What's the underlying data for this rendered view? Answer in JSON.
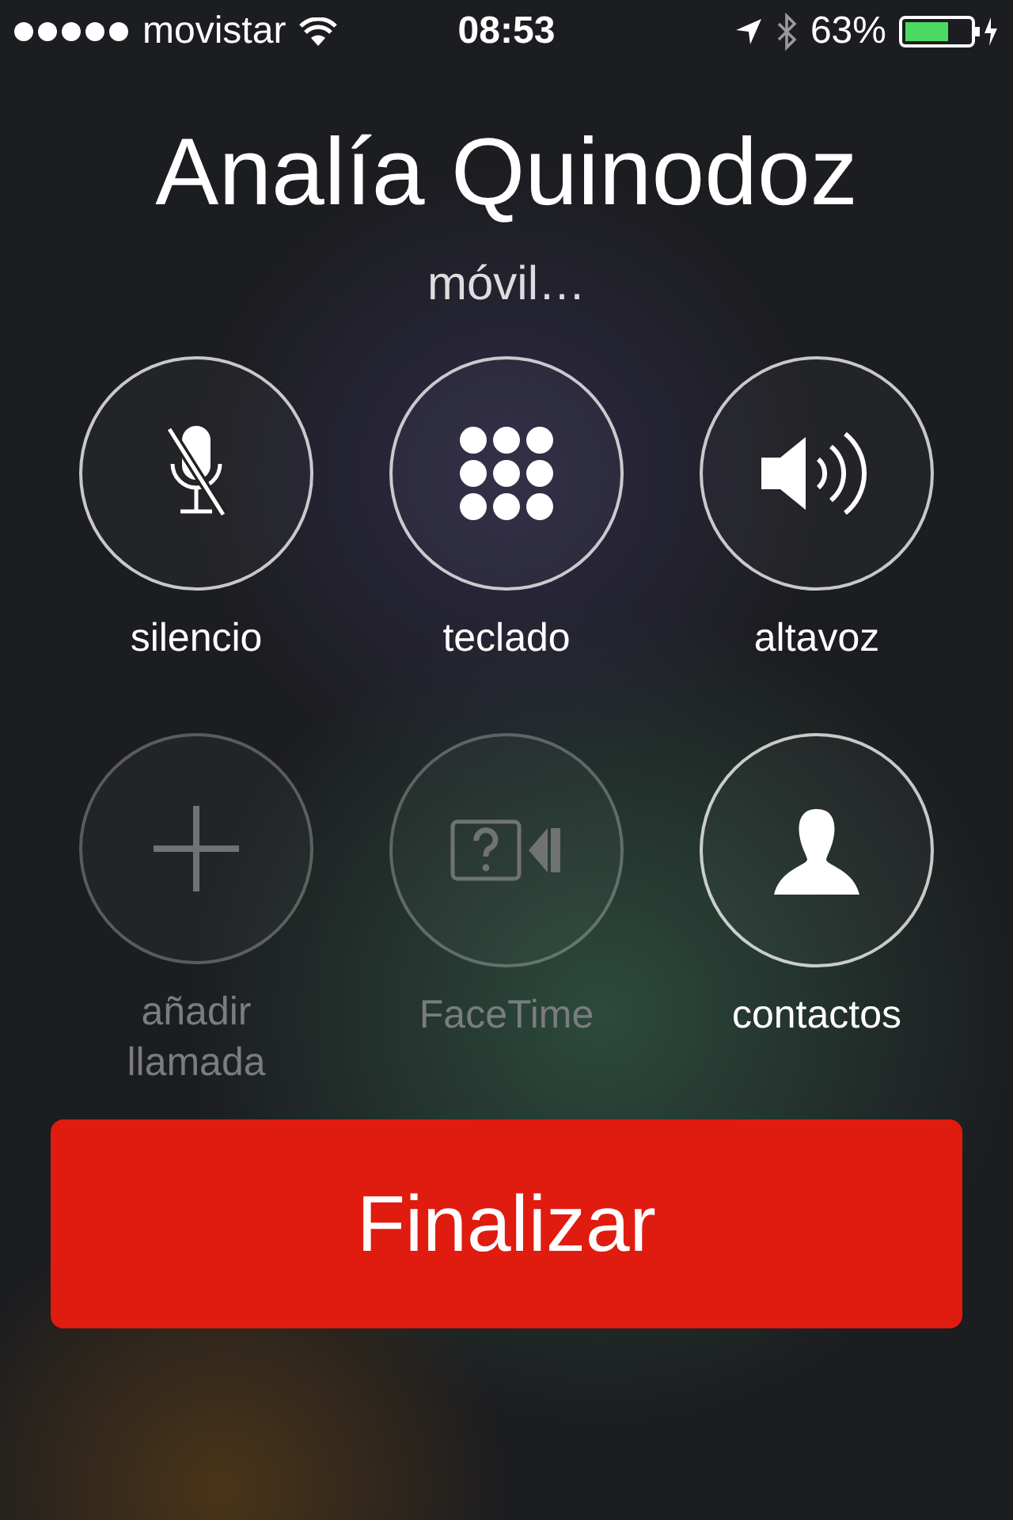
{
  "status_bar": {
    "carrier": "movistar",
    "time": "08:53",
    "battery_percent": "63%"
  },
  "call": {
    "name": "Analía Quinodoz",
    "status": "móvil…"
  },
  "controls": [
    {
      "kind": "mute",
      "label": "silencio",
      "disabled": false
    },
    {
      "kind": "keypad",
      "label": "teclado",
      "disabled": false
    },
    {
      "kind": "speaker",
      "label": "altavoz",
      "disabled": false
    },
    {
      "kind": "add",
      "label": "añadir llamada",
      "disabled": true
    },
    {
      "kind": "facetime",
      "label": "FaceTime",
      "disabled": true
    },
    {
      "kind": "contacts",
      "label": "contactos",
      "disabled": false
    }
  ],
  "end_button": {
    "label": "Finalizar"
  }
}
